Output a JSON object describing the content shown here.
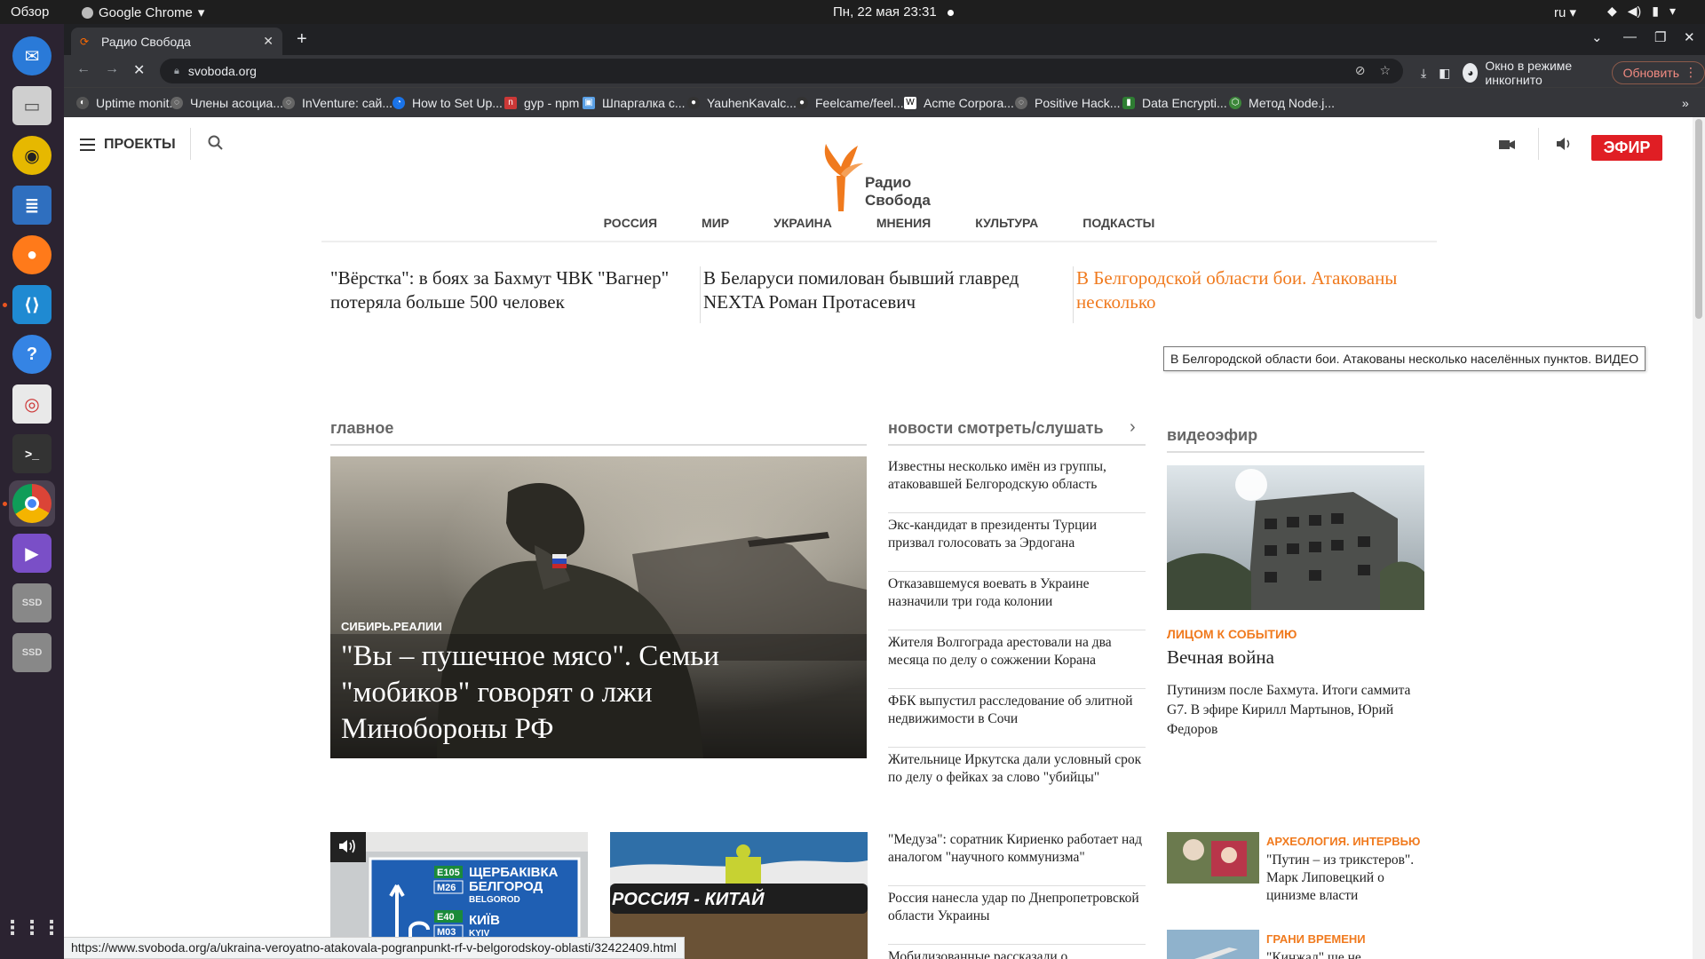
{
  "topbar": {
    "overview": "Обзор",
    "app_name": "Google Chrome",
    "clock": "Пн, 22 мая  23:31",
    "lang": "ru"
  },
  "dock": {
    "items": [
      "thunderbird-icon",
      "files-icon",
      "rhythmbox-icon",
      "writer-icon",
      "firefox-icon",
      "vscode-icon",
      "help-icon",
      "reader-icon",
      "terminal-icon",
      "chrome-icon",
      "media-player-icon",
      "ssd-drive-icon",
      "ssd-drive-icon",
      "app-grid-icon"
    ],
    "ssd_label": "SSD"
  },
  "browser": {
    "tab_title": "Радио Свобода",
    "url": "svoboda.org",
    "incognito_label": "Окно в режиме инкогнито",
    "update_label": "Обновить",
    "bookmarks": [
      "Uptime monit...",
      "Члены асоциа...",
      "InVenture: сай...",
      "How to Set Up...",
      "gyp - npm",
      "Шпаргалка с...",
      "YauhenKavalc...",
      "Feelcame/feel...",
      "Acme Corpora...",
      "Positive Hack...",
      "Data Encrypti...",
      "Метод Node.j..."
    ],
    "bookmarks_more": "»",
    "status_url": "https://www.svoboda.org/a/ukraina-veroyatno-atakovala-pogranpunkt-rf-v-belgorodskoy-oblasti/32422409.html"
  },
  "site": {
    "projects_label": "ПРОЕКТЫ",
    "logo_line1": "Радио",
    "logo_line2": "Свобода",
    "efir_label": "ЭФИР",
    "nav": [
      "РОССИЯ",
      "МИР",
      "УКРАИНА",
      "МНЕНИЯ",
      "КУЛЬТУРА",
      "ПОДКАСТЫ"
    ],
    "top_links": [
      "\"Вёрстка\": в боях за Бахмут ЧВК \"Вагнер\" потеряла больше 500 человек",
      "В Беларуси помилован бывший главред NEXTA Роман Протасевич",
      "В Белгородской области бои. Атакованы несколько"
    ],
    "tooltip": "В Белгородской области бои. Атакованы несколько населённых пунктов. ВИДЕО",
    "main_section": "главное",
    "hero_kicker": "СИБИРЬ.РЕАЛИИ",
    "hero_headline": "\"Вы – пушечное мясо\". Семьи \"мобиков\" говорят о лжи Минобороны РФ",
    "news_section": "новости смотреть/слушать",
    "news": [
      "Известны несколько имён из группы, атаковавшей Белгородскую область",
      "Экс-кандидат в президенты Турции призвал голосовать за Эрдогана",
      "Отказавшемуся воевать в Украине назначили три года колонии",
      "Жителя Волгограда арестовали на два месяца по делу о сожжении Корана",
      "ФБК выпустил расследование об элитной недвижимости в Сочи",
      "Жительнице Иркутска дали условный срок по делу о фейках за слово \"убийцы\""
    ],
    "news2": [
      "\"Медуза\": соратник Кириенко работает над аналогом \"научного коммунизма\"",
      "Россия нанесла удар по Днепропетровской области Украины",
      "Мобилизованные рассказали о"
    ],
    "video_section": "видеоэфир",
    "video_kicker": "ЛИЦОМ К СОБЫТИЮ",
    "video_title": "Вечная война",
    "video_desc": "Путинизм после Бахмута. Итоги саммита G7. В эфире Кирилл Мартынов, Юрий Федоров",
    "side1_kicker": "АРХЕОЛОГИЯ. ИНТЕРВЬЮ",
    "side1_title": "\"Путин – из трикстеров\". Марк Липовецкий о цинизме власти",
    "side2_kicker": "ГРАНИ ВРЕМЕНИ",
    "side2_title": "\"Кинжал\" ще не",
    "road_sign": {
      "r1": "E105",
      "r2": "M26",
      "r3": "E40",
      "r4": "M03",
      "city1": "ЩЕРБАКІВКА",
      "city2": "БЕЛГОРОД",
      "city2b": "BELGOROD",
      "city3": "КИЇВ",
      "city3b": "KYIV"
    },
    "pipeline_text": "РОССИЯ - КИТАЙ"
  },
  "colors": {
    "accent": "#f07a1e",
    "efir_red": "#e01e24",
    "dock_bg": "#2b2331",
    "chrome_bg": "#202124"
  }
}
